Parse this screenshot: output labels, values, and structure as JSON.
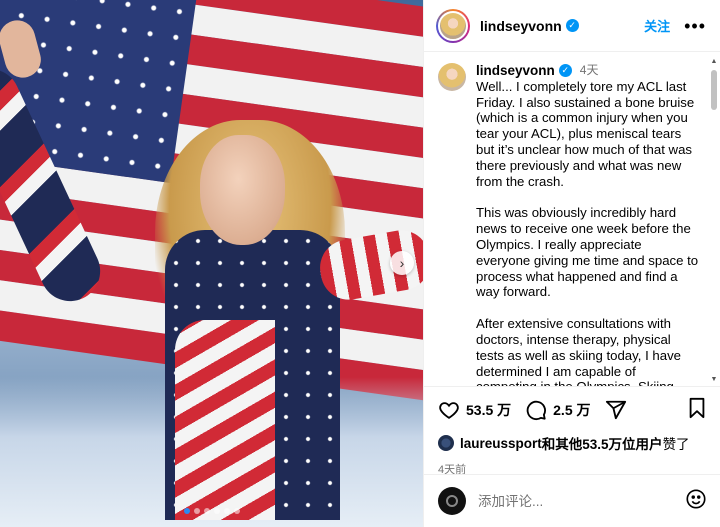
{
  "post": {
    "username": "lindseyvonn",
    "follow_label": "关注",
    "more_label": "•••",
    "next_arrow": "›",
    "carousel": {
      "slide_count": 6,
      "active_index": 0
    }
  },
  "caption": {
    "username": "lindseyvonn",
    "time": "4天",
    "paragraphs": [
      "Well... I completely tore my ACL last Friday. I also sustained a bone bruise (which is a common injury when you tear your ACL), plus meniscal tears but it’s unclear how much of that was there previously and what was new from the crash.",
      "This was obviously incredibly hard news to receive one week before the Olympics. I really appreciate everyone giving me time and space to process what happened and find a way forward.",
      "After extensive consultations with doctors, intense therapy, physical tests as well as skiing today, I have determined I am capable of competing in the Olympics. Skiing"
    ]
  },
  "actions": {
    "likes_count": "53.5 万",
    "comments_count": "2.5 万"
  },
  "likes": {
    "user": "laureussport",
    "text": "和其他53.5万位用户",
    "suffix": "赞了"
  },
  "post_time": "4天前",
  "comment": {
    "placeholder": "添加评论..."
  },
  "icons": {
    "verified": "verified-badge-icon",
    "like": "heart-icon",
    "comment": "comment-bubble-icon",
    "share": "send-icon",
    "save": "bookmark-icon",
    "emoji": "emoji-smile-icon"
  },
  "colors": {
    "accent": "#0095f6",
    "muted_text": "#737373",
    "carousel_active": "#2a8bf2"
  }
}
